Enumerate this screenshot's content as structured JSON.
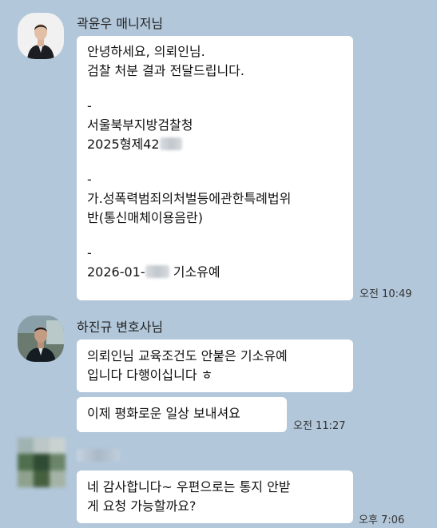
{
  "messages": [
    {
      "sender": "곽윤우 매니저님",
      "lines": [
        "안녕하세요, 의뢰인님.",
        "검찰 처분 결과 전달드립니다.",
        "",
        "-",
        "서울북부지방검찰청",
        "2025형제42",
        "",
        "-",
        "가.성폭력범죄의처벌등에관한특례법위",
        "반(통신매체이용음란)",
        "",
        "-",
        "2026-01-",
        ""
      ],
      "inline_tail": "기소유예",
      "time": "오전 10:49"
    },
    {
      "sender": "하진규 변호사님",
      "bubble1_lines": [
        "의뢰인님 교육조건도 안붙은 기소유예",
        "입니다 다행이십니다 ㅎ"
      ],
      "bubble2": "이제 평화로운 일상 보내셔요",
      "time": "오전 11:27"
    },
    {
      "sender": "",
      "lines": [
        "네 감사합니다~ 우편으로는 통지 안받",
        "게 요청 가능할까요?"
      ],
      "time": "오후 7:06"
    }
  ]
}
